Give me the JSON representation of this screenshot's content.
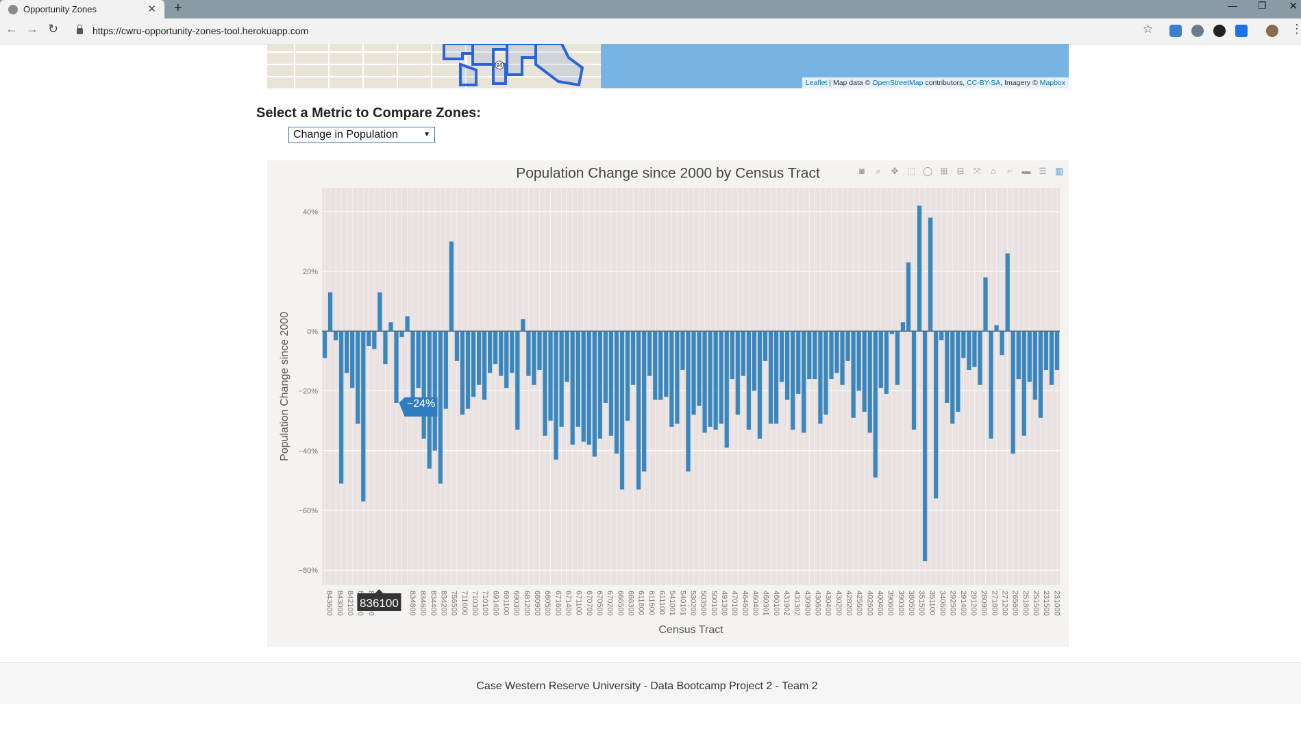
{
  "browser": {
    "tab_title": "Opportunity Zones",
    "url": "https://cwru-opportunity-zones-tool.herokuapp.com"
  },
  "map": {
    "attribution": {
      "leaflet": "Leaflet",
      "sep1": " | Map data © ",
      "osm": "OpenStreetMap",
      "contrib": " contributors, ",
      "license": "CC-BY-SA",
      "imagery": ", Imagery © ",
      "mapbox": "Mapbox"
    },
    "shield": "94"
  },
  "metric": {
    "label": "Select a Metric to Compare Zones:",
    "selected": "Change in Population"
  },
  "chart_data": {
    "type": "bar",
    "title": "Population Change since 2000 by Census Tract",
    "xlabel": "Census Tract",
    "ylabel": "Population Change since 2000",
    "ylim": [
      -85,
      48
    ],
    "yticks": [
      40,
      20,
      0,
      -20,
      -40,
      -60,
      -80
    ],
    "ytick_labels": [
      "40%",
      "20%",
      "0%",
      "−20%",
      "−40%",
      "−60%",
      "−80%"
    ],
    "xtick_labels": [
      "843600",
      "843000",
      "842100",
      "841500",
      "841000",
      "",
      "",
      "",
      "834800",
      "834600",
      "834400",
      "834200",
      "756500",
      "711000",
      "710300",
      "710100",
      "691400",
      "691100",
      "690300",
      "681200",
      "680900",
      "680500",
      "671600",
      "671400",
      "671100",
      "670700",
      "670500",
      "670200",
      "666500",
      "666300",
      "611800",
      "611600",
      "611100",
      "541001",
      "540101",
      "530200",
      "503500",
      "500100",
      "491300",
      "470100",
      "464600",
      "460400",
      "460301",
      "460100",
      "431902",
      "431302",
      "430900",
      "430600",
      "430400",
      "430200",
      "428200",
      "425600",
      "402600",
      "400400",
      "390600",
      "390300",
      "380500",
      "351500",
      "351100",
      "340600",
      "292500",
      "291400",
      "291200",
      "280900",
      "271800",
      "271200",
      "265600",
      "251800",
      "251500",
      "231500",
      "231000"
    ],
    "values": [
      -9,
      13,
      -3,
      -51,
      -14,
      -19,
      -31,
      -57,
      -5,
      -6,
      13,
      -11,
      3,
      -24,
      -2,
      5,
      -28,
      -19,
      -36,
      -46,
      -40,
      -51,
      -26,
      30,
      -10,
      -28,
      -26,
      -22,
      -18,
      -23,
      -14,
      -11,
      -15,
      -19,
      -14,
      -33,
      4,
      -15,
      -18,
      -13,
      -35,
      -30,
      -43,
      -32,
      -17,
      -38,
      -32,
      -37,
      -38,
      -42,
      -36,
      -24,
      -35,
      -41,
      -53,
      -30,
      -18,
      -53,
      -47,
      -15,
      -23,
      -23,
      -22,
      -32,
      -31,
      -13,
      -47,
      -28,
      -25,
      -34,
      -32,
      -33,
      -31,
      -39,
      -16,
      -28,
      -15,
      -33,
      -20,
      -36,
      -10,
      -31,
      -31,
      -17,
      -23,
      -33,
      -21,
      -34,
      -16,
      -16,
      -31,
      -28,
      -16,
      -14,
      -18,
      -10,
      -29,
      -20,
      -27,
      -34,
      -49,
      -19,
      -21,
      -1,
      -18,
      3,
      23,
      -33,
      42,
      -77,
      38,
      -56,
      -3,
      -24,
      -31,
      -27,
      -9,
      -13,
      -12,
      -18,
      18,
      -36,
      2,
      -8,
      26,
      -41,
      -16,
      -35,
      -17,
      -23,
      -29,
      -13,
      -18,
      -13
    ],
    "bar_color": "#3a87c0",
    "plot_bg": "#e9e2e1",
    "paper_bg": "#f4f3f1",
    "hover": {
      "index": 13,
      "value_label": "−24%",
      "x_label": "836100"
    },
    "grid": true,
    "legend": "none"
  },
  "modebar": [
    "camera-icon",
    "zoom-icon",
    "pan-icon",
    "box-select-icon",
    "lasso-icon",
    "zoom-in-icon",
    "zoom-out-icon",
    "autoscale-icon",
    "reset-axes-icon",
    "spike-lines-icon",
    "hover-closest-icon",
    "hover-compare-icon",
    "plotly-logo-icon"
  ],
  "footer": {
    "text": "Case Western Reserve University - Data Bootcamp Project 2 - Team 2"
  }
}
